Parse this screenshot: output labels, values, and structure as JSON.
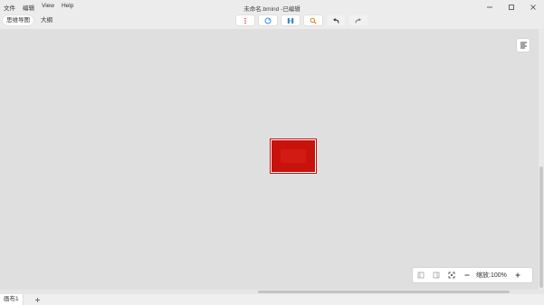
{
  "app": {
    "window_title": "未命名.bmind -已编辑",
    "menu": [
      "文件",
      "编辑",
      "View",
      "Help"
    ]
  },
  "toolbar": {
    "view_tabs": [
      {
        "label": "思维导图",
        "active": true
      },
      {
        "label": "大纲",
        "active": false
      }
    ],
    "tools": [
      {
        "icon": "more-vertical-icon"
      },
      {
        "icon": "style-palette-icon"
      },
      {
        "icon": "layout-structure-icon"
      },
      {
        "icon": "search-icon"
      },
      {
        "icon": "undo-icon"
      },
      {
        "icon": "redo-icon"
      }
    ]
  },
  "canvas": {
    "topic": {
      "text": "",
      "fill_color": "#c8120c"
    },
    "format_panel_icon": "format-panel-icon"
  },
  "zoom": {
    "label": "缩放:100%",
    "value_percent": 100
  },
  "sheets": {
    "tabs": [
      "画布1"
    ],
    "add_icon": "plus-icon"
  },
  "colors": {
    "accent_blue": "#3a8ee6",
    "topic_red": "#c8120c",
    "search_orange": "#e07b1a"
  }
}
